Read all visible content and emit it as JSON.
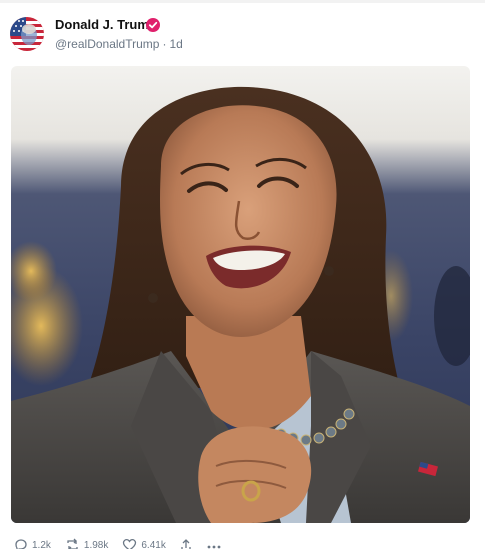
{
  "post": {
    "author": {
      "display_name": "Donald J. Trump",
      "handle": "@realDonaldTrump",
      "time_ago": "1d",
      "separator": "·",
      "verified": true,
      "avatar": "american-flag-portrait"
    },
    "media": {
      "subject": "smiling woman with shoulder-length hair in dark blazer and beaded necklace"
    },
    "actions": {
      "replies": "1.2k",
      "reposts": "1.98k",
      "likes": "6.41k"
    }
  },
  "colors": {
    "verified_badge": "#e0206c",
    "muted_text": "#6b7785",
    "name_text": "#111111"
  }
}
